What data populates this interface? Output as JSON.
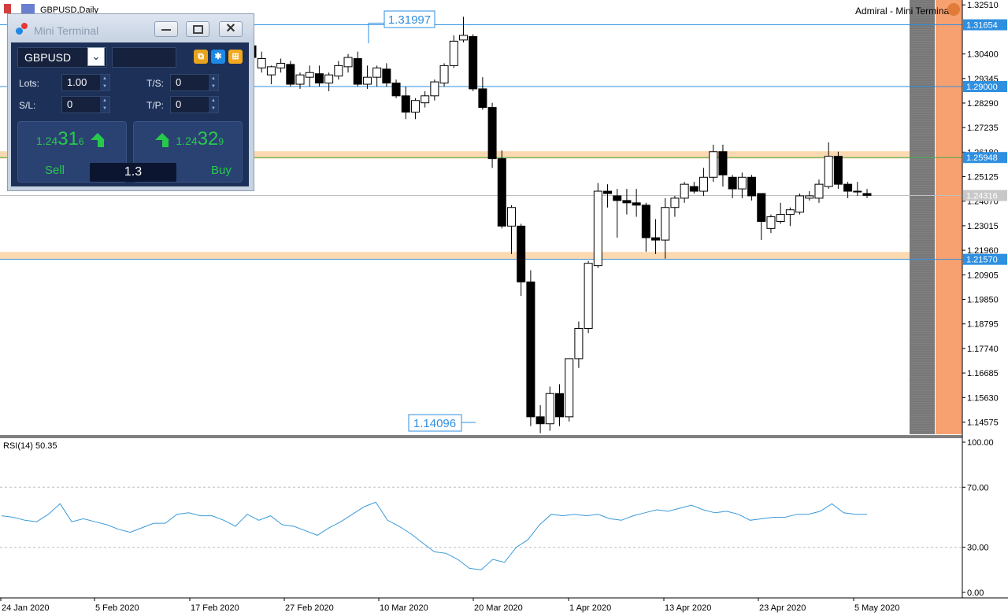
{
  "chart": {
    "title": "GBPUSD,Daily",
    "ea_label": "Admiral - Mini Terminal",
    "price_axis": {
      "ticks": [
        "1.32510",
        "1.31654",
        "1.30400",
        "1.29345",
        "1.29000",
        "1.28290",
        "1.27235",
        "1.26180",
        "1.25948",
        "1.25125",
        "1.24316",
        "1.24070",
        "1.23015",
        "1.21960",
        "1.21570",
        "1.20905",
        "1.19850",
        "1.18795",
        "1.17740",
        "1.16685",
        "1.15630",
        "1.14575"
      ],
      "highlighted": [
        {
          "label": "1.31654",
          "value": 1.31654
        },
        {
          "label": "1.29000",
          "value": 1.29
        },
        {
          "label": "1.25948",
          "value": 1.25948
        },
        {
          "label": "1.24316",
          "value": 1.24316
        },
        {
          "label": "1.21570",
          "value": 1.2157
        }
      ]
    },
    "high_label": "1.31997",
    "low_label": "1.14096",
    "time_axis": [
      "24 Jan 2020",
      "5 Feb 2020",
      "17 Feb 2020",
      "27 Feb 2020",
      "10 Mar 2020",
      "20 Mar 2020",
      "1 Apr 2020",
      "13 Apr 2020",
      "23 Apr 2020",
      "5 May 2020"
    ],
    "zones": [
      {
        "from": 1.259,
        "to": 1.2622,
        "color": "#fcd9b0"
      },
      {
        "from": 1.2157,
        "to": 1.2189,
        "color": "#fcd9b0"
      }
    ],
    "colors": {
      "hline": "#2f8fe0",
      "green_line": "#4caf50",
      "gray_line": "#c0c0c0",
      "bear": "#000000",
      "bull": "#ffffff",
      "rsi": "#3a9ad9",
      "grid": "#bdbdbd"
    }
  },
  "chart_data": {
    "type": "candlestick",
    "ylim": [
      1.1405,
      1.3272
    ],
    "candles": [
      [
        1.3075,
        1.31,
        1.301,
        1.3025
      ],
      [
        1.298,
        1.305,
        1.296,
        1.302
      ],
      [
        1.295,
        1.299,
        1.291,
        1.2985
      ],
      [
        1.298,
        1.302,
        1.296,
        1.3
      ],
      [
        1.2995,
        1.301,
        1.29,
        1.291
      ],
      [
        1.291,
        1.296,
        1.289,
        1.295
      ],
      [
        1.294,
        1.299,
        1.29,
        1.296
      ],
      [
        1.2955,
        1.299,
        1.29,
        1.2915
      ],
      [
        1.2915,
        1.296,
        1.288,
        1.295
      ],
      [
        1.2945,
        1.301,
        1.293,
        1.299
      ],
      [
        1.2985,
        1.304,
        1.296,
        1.3025
      ],
      [
        1.302,
        1.305,
        1.29,
        1.291
      ],
      [
        1.291,
        1.299,
        1.289,
        1.294
      ],
      [
        1.294,
        1.299,
        1.29,
        1.298
      ],
      [
        1.2975,
        1.3,
        1.29,
        1.2915
      ],
      [
        1.2915,
        1.293,
        1.285,
        1.286
      ],
      [
        1.286,
        1.29,
        1.276,
        1.279
      ],
      [
        1.279,
        1.285,
        1.276,
        1.284
      ],
      [
        1.283,
        1.288,
        1.281,
        1.286
      ],
      [
        1.286,
        1.293,
        1.284,
        1.292
      ],
      [
        1.2915,
        1.3,
        1.29,
        1.299
      ],
      [
        1.299,
        1.312,
        1.298,
        1.3095
      ],
      [
        1.31,
        1.32,
        1.309,
        1.312
      ],
      [
        1.3115,
        1.3125,
        1.288,
        1.289
      ],
      [
        1.289,
        1.294,
        1.28,
        1.281
      ],
      [
        1.281,
        1.283,
        1.255,
        1.259
      ],
      [
        1.259,
        1.2625,
        1.229,
        1.23
      ],
      [
        1.23,
        1.239,
        1.218,
        1.238
      ],
      [
        1.23,
        1.231,
        1.2,
        1.206
      ],
      [
        1.206,
        1.211,
        1.144,
        1.148
      ],
      [
        1.148,
        1.153,
        1.141,
        1.145
      ],
      [
        1.145,
        1.161,
        1.142,
        1.158
      ],
      [
        1.158,
        1.162,
        1.144,
        1.148
      ],
      [
        1.148,
        1.173,
        1.146,
        1.173
      ],
      [
        1.173,
        1.189,
        1.169,
        1.186
      ],
      [
        1.186,
        1.215,
        1.184,
        1.214
      ],
      [
        1.213,
        1.2485,
        1.212,
        1.245
      ],
      [
        1.245,
        1.248,
        1.238,
        1.244
      ],
      [
        1.243,
        1.246,
        1.225,
        1.241
      ],
      [
        1.241,
        1.246,
        1.235,
        1.24
      ],
      [
        1.24,
        1.246,
        1.234,
        1.239
      ],
      [
        1.239,
        1.24,
        1.219,
        1.225
      ],
      [
        1.225,
        1.233,
        1.218,
        1.224
      ],
      [
        1.224,
        1.242,
        1.216,
        1.238
      ],
      [
        1.238,
        1.243,
        1.234,
        1.242
      ],
      [
        1.242,
        1.249,
        1.24,
        1.248
      ],
      [
        1.247,
        1.249,
        1.244,
        1.245
      ],
      [
        1.245,
        1.255,
        1.243,
        1.251
      ],
      [
        1.251,
        1.265,
        1.249,
        1.262
      ],
      [
        1.262,
        1.265,
        1.247,
        1.252
      ],
      [
        1.251,
        1.252,
        1.242,
        1.246
      ],
      [
        1.246,
        1.253,
        1.242,
        1.251
      ],
      [
        1.251,
        1.252,
        1.241,
        1.243
      ],
      [
        1.244,
        1.244,
        1.224,
        1.232
      ],
      [
        1.229,
        1.235,
        1.227,
        1.234
      ],
      [
        1.232,
        1.24,
        1.231,
        1.235
      ],
      [
        1.235,
        1.238,
        1.23,
        1.237
      ],
      [
        1.236,
        1.244,
        1.235,
        1.243
      ],
      [
        1.242,
        1.245,
        1.241,
        1.243
      ],
      [
        1.242,
        1.25,
        1.24,
        1.248
      ],
      [
        1.247,
        1.266,
        1.246,
        1.26
      ],
      [
        1.26,
        1.262,
        1.246,
        1.248
      ],
      [
        1.248,
        1.249,
        1.242,
        1.245
      ],
      [
        1.245,
        1.249,
        1.243,
        1.245
      ],
      [
        1.244,
        1.246,
        1.242,
        1.2432
      ]
    ],
    "rsi": {
      "name": "RSI(14) 50.35",
      "levels": [
        100.0,
        70.0,
        30.0,
        0.0
      ],
      "values": [
        51,
        50,
        48,
        47,
        52,
        59,
        47,
        49,
        47,
        45,
        42,
        40,
        43,
        46,
        46,
        52,
        53,
        51,
        51,
        48,
        44,
        52,
        48,
        51,
        45,
        44,
        41,
        38,
        43,
        47,
        52,
        57,
        60,
        48,
        44,
        39,
        33,
        27,
        26,
        22,
        16,
        15,
        22,
        20,
        30,
        35,
        45,
        52,
        51,
        52,
        51,
        52,
        49,
        48,
        51,
        53,
        55,
        54,
        56,
        58,
        55,
        53,
        54,
        52,
        48,
        49,
        50,
        50,
        52,
        52,
        54,
        59,
        53,
        52,
        52
      ]
    }
  },
  "terminal": {
    "title": "Mini Terminal",
    "symbol": "GBPUSD",
    "lots_label": "Lots:",
    "lots": "1.00",
    "ts_label": "T/S:",
    "ts": "0",
    "sl_label": "S/L:",
    "sl": "0",
    "tp_label": "T/P:",
    "tp": "0",
    "sell_price_a": "1.24",
    "sell_price_b": "31",
    "sell_price_c": "6",
    "buy_price_a": "1.24",
    "buy_price_b": "32",
    "buy_price_c": "9",
    "sell_label": "Sell",
    "buy_label": "Buy",
    "spread": "1.3"
  }
}
